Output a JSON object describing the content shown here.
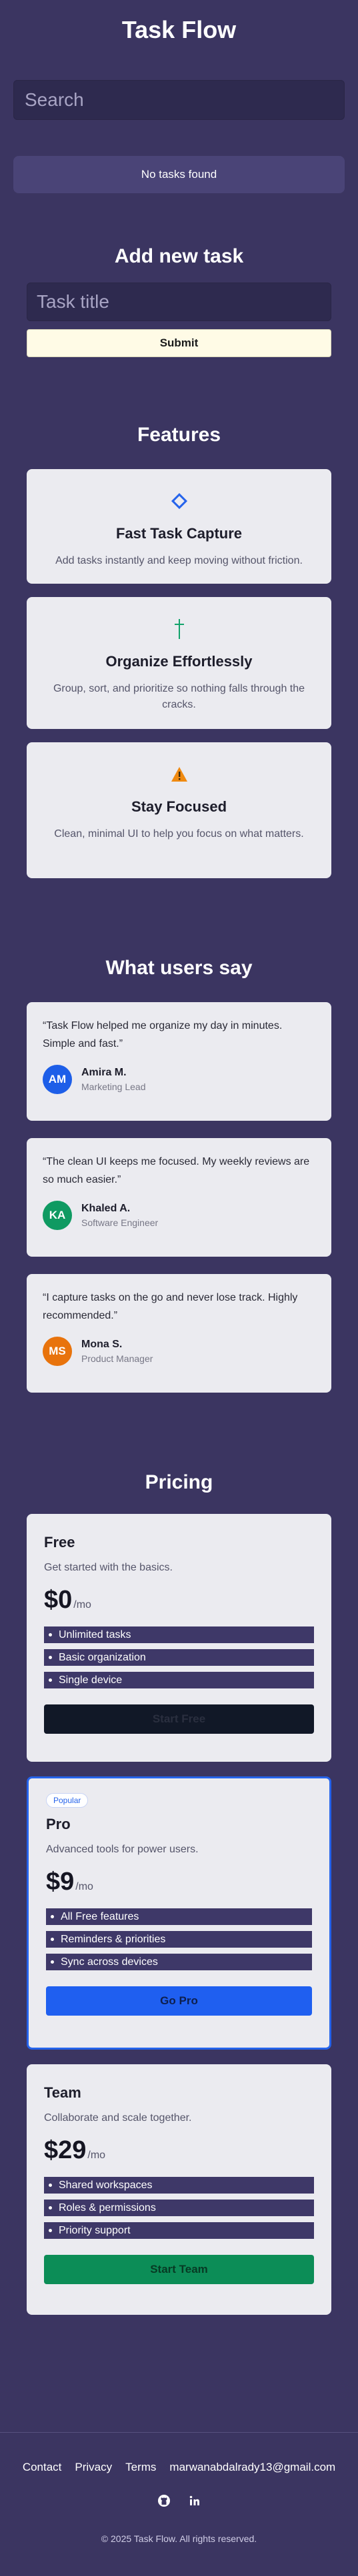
{
  "app": {
    "title": "Task Flow"
  },
  "search": {
    "placeholder": "Search"
  },
  "tasks": {
    "empty_text": "No tasks found"
  },
  "add_task": {
    "title": "Add new task",
    "input_placeholder": "Task title",
    "submit_label": "Submit"
  },
  "features": {
    "title": "Features",
    "items": [
      {
        "icon": "diamond-icon",
        "name": "Fast Task Capture",
        "desc": "Add tasks instantly and keep moving without friction."
      },
      {
        "icon": "dagger-icon",
        "name": "Organize Effortlessly",
        "desc": "Group, sort, and prioritize so nothing falls through the cracks."
      },
      {
        "icon": "warning-icon",
        "name": "Stay Focused",
        "desc": "Clean, minimal UI to help you focus on what matters."
      }
    ]
  },
  "testimonials": {
    "title": "What users say",
    "items": [
      {
        "quote": "“Task Flow helped me organize my day in minutes. Simple and fast.”",
        "initials": "AM",
        "name": "Amira M.",
        "role": "Marketing Lead",
        "color": "#1d5ee8"
      },
      {
        "quote": "“The clean UI keeps me focused. My weekly reviews are so much easier.”",
        "initials": "KA",
        "name": "Khaled A.",
        "role": "Software Engineer",
        "color": "#0f9a62"
      },
      {
        "quote": "“I capture tasks on the go and never lose track. Highly recommended.”",
        "initials": "MS",
        "name": "Mona S.",
        "role": "Product Manager",
        "color": "#e8730c"
      }
    ]
  },
  "pricing": {
    "title": "Pricing",
    "plans": [
      {
        "name": "Free",
        "desc": "Get started with the basics.",
        "price": "$0",
        "per": "/mo",
        "features": [
          "Unlimited tasks",
          "Basic organization",
          "Single device"
        ],
        "button": "Start Free",
        "button_color": "#111827",
        "button_text_color": "#2a2f3f"
      },
      {
        "badge": "Popular",
        "name": "Pro",
        "desc": "Advanced tools for power users.",
        "price": "$9",
        "per": "/mo",
        "features": [
          "All Free features",
          "Reminders & priorities",
          "Sync across devices"
        ],
        "button": "Go Pro",
        "button_color": "#1f5ff0",
        "button_text_color": "#0e1f4d"
      },
      {
        "name": "Team",
        "desc": "Collaborate and scale together.",
        "price": "$29",
        "per": "/mo",
        "features": [
          "Shared workspaces",
          "Roles & permissions",
          "Priority support"
        ],
        "button": "Start Team",
        "button_color": "#0c8d57",
        "button_text_color": "#073a24"
      }
    ]
  },
  "footer": {
    "links": [
      "Contact",
      "Privacy",
      "Terms",
      "marwanabdalrady13@gmail.com"
    ],
    "icons": [
      "github-icon",
      "linkedin-icon"
    ],
    "copyright": "© 2025 Task Flow. All rights reserved."
  }
}
